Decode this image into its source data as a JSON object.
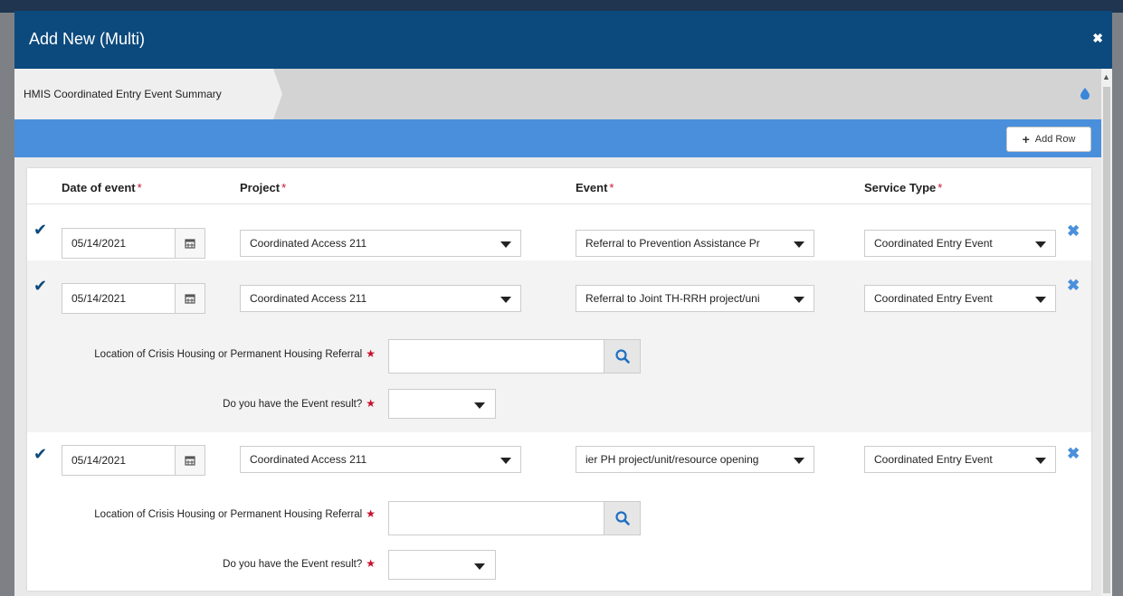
{
  "modal": {
    "title": "Add New (Multi)",
    "close_icon": "close-icon"
  },
  "breadcrumb": {
    "label": "HMIS Coordinated Entry Event Summary",
    "icon": "drop-icon"
  },
  "toolbar": {
    "add_row_label": "Add Row"
  },
  "table": {
    "headers": {
      "date": "Date of event",
      "project": "Project",
      "event": "Event",
      "service_type": "Service Type",
      "required_mark": "*"
    },
    "rows": [
      {
        "date": "05/14/2021",
        "project": "Coordinated Access 211",
        "event": "Referral to Prevention Assistance Pr",
        "service_type": "Coordinated Entry Event"
      },
      {
        "date": "05/14/2021",
        "project": "Coordinated Access 211",
        "event": "Referral to Joint TH-RRH project/uni",
        "service_type": "Coordinated Entry Event",
        "extra": {
          "location_label": "Location of Crisis Housing or Permanent Housing Referral",
          "result_label": "Do you have the Event result?"
        }
      },
      {
        "date": "05/14/2021",
        "project": "Coordinated Access 211",
        "event": "ier PH project/unit/resource opening",
        "service_type": "Coordinated Entry Event",
        "extra": {
          "location_label": "Location of Crisis Housing or Permanent Housing Referral",
          "result_label": "Do you have the Event result?"
        }
      }
    ]
  },
  "colors": {
    "header_bg": "#0c4a7d",
    "accent_blue": "#4a8fdb",
    "required_red": "#c8102e"
  }
}
